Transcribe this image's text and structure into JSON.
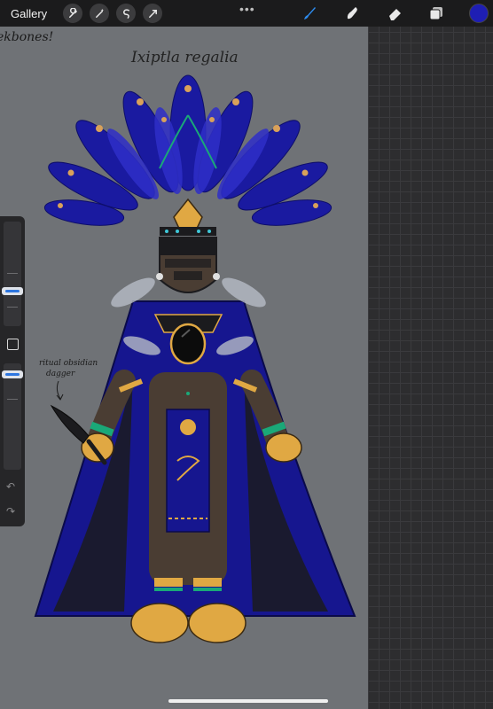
{
  "topbar": {
    "gallery_label": "Gallery",
    "left_tools": [
      "wrench-icon",
      "magic-wand-icon",
      "selection-icon",
      "transform-icon"
    ],
    "more_label": "•••",
    "right_tools": [
      "brush-icon",
      "smudge-icon",
      "eraser-icon",
      "layers-icon"
    ],
    "active_tool": "brush-icon",
    "current_color": "#1e1eb4"
  },
  "sidebar": {
    "brush_size_level": 0.55,
    "opacity_level": 0.82,
    "modify_button": "square-icon",
    "undo_icon": "↶",
    "redo_icon": "↷"
  },
  "artwork": {
    "title": "Ixiptla regalia",
    "partial_text": "ekbones!",
    "annotation_line1": "ritual obsidian",
    "annotation_line2": "dagger",
    "palette": {
      "feather": "#1a1aa0",
      "feather_light": "#2f2fc8",
      "skin": "#4a3d33",
      "gold": "#e0a843",
      "cape": "#16168f",
      "black": "#1b1b1e",
      "teal": "#1aa878"
    }
  }
}
